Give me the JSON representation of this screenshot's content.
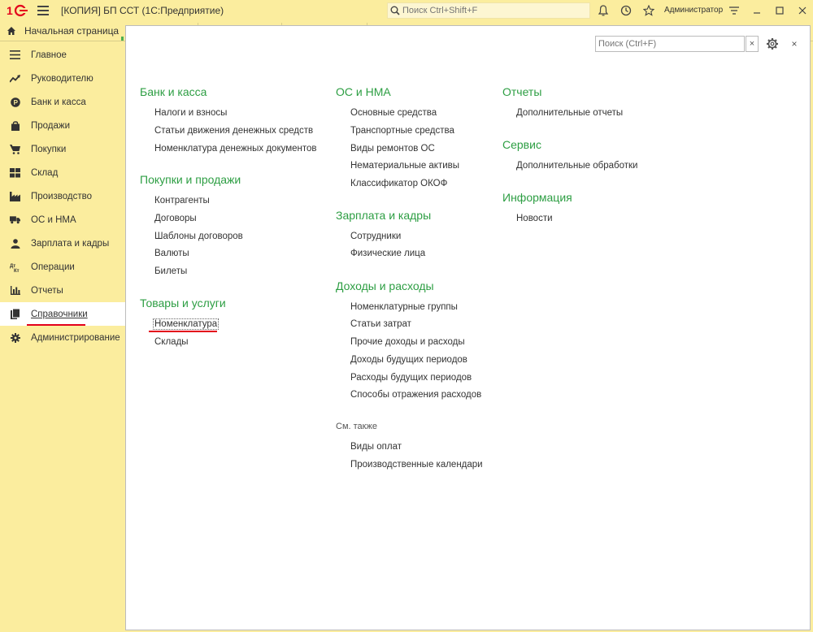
{
  "app": {
    "title": "[КОПИЯ] БП ССТ  (1С:Предприятие)",
    "search_placeholder": "Поиск Ctrl+Shift+F",
    "user": "Администратор"
  },
  "tabs": {
    "home": "Начальная страница"
  },
  "sidebar": {
    "items": [
      {
        "label": "Главное",
        "icon": "list-icon"
      },
      {
        "label": "Руководителю",
        "icon": "trend-icon"
      },
      {
        "label": "Банк и касса",
        "icon": "coin-icon"
      },
      {
        "label": "Продажи",
        "icon": "bag-icon"
      },
      {
        "label": "Покупки",
        "icon": "cart-icon"
      },
      {
        "label": "Склад",
        "icon": "warehouse-icon"
      },
      {
        "label": "Производство",
        "icon": "factory-icon"
      },
      {
        "label": "ОС и НМА",
        "icon": "truck-icon"
      },
      {
        "label": "Зарплата и кадры",
        "icon": "person-icon"
      },
      {
        "label": "Операции",
        "icon": "dt-kt-icon"
      },
      {
        "label": "Отчеты",
        "icon": "bar-chart-icon"
      },
      {
        "label": "Справочники",
        "icon": "books-icon",
        "active": true
      },
      {
        "label": "Администрирование",
        "icon": "gear-icon"
      }
    ]
  },
  "panel": {
    "search_placeholder": "Поиск (Ctrl+F)",
    "clear_label": "×",
    "close_label": "×",
    "col1": {
      "bank": {
        "title": "Банк и касса",
        "links": [
          "Налоги и взносы",
          "Статьи движения денежных средств",
          "Номенклатура денежных документов"
        ]
      },
      "purchases": {
        "title": "Покупки и продажи",
        "links": [
          "Контрагенты",
          "Договоры",
          "Шаблоны договоров",
          "Валюты",
          "Билеты"
        ]
      },
      "goods": {
        "title": "Товары и услуги",
        "links": [
          "Номенклатура",
          "Склады"
        ]
      }
    },
    "col2": {
      "os": {
        "title": "ОС и НМА",
        "links": [
          "Основные средства",
          "Транспортные средства",
          "Виды ремонтов ОС",
          "Нематериальные активы",
          "Классификатор ОКОФ"
        ]
      },
      "salary": {
        "title": "Зарплата и кадры",
        "links": [
          "Сотрудники",
          "Физические лица"
        ]
      },
      "income": {
        "title": "Доходы и расходы",
        "links": [
          "Номенклатурные группы",
          "Статьи затрат",
          "Прочие доходы и расходы",
          "Доходы будущих периодов",
          "Расходы будущих периодов",
          "Способы отражения расходов"
        ]
      },
      "see_also": {
        "title": "См. также",
        "links": [
          "Виды оплат",
          "Производственные календари"
        ]
      }
    },
    "col3": {
      "reports": {
        "title": "Отчеты",
        "links": [
          "Дополнительные отчеты"
        ]
      },
      "service": {
        "title": "Сервис",
        "links": [
          "Дополнительные обработки"
        ]
      },
      "info": {
        "title": "Информация",
        "links": [
          "Новости"
        ]
      }
    }
  },
  "colors": {
    "accent_green": "#2d9e43",
    "sidebar_bg": "#fbed9e",
    "highlight_red": "#e3001b"
  }
}
